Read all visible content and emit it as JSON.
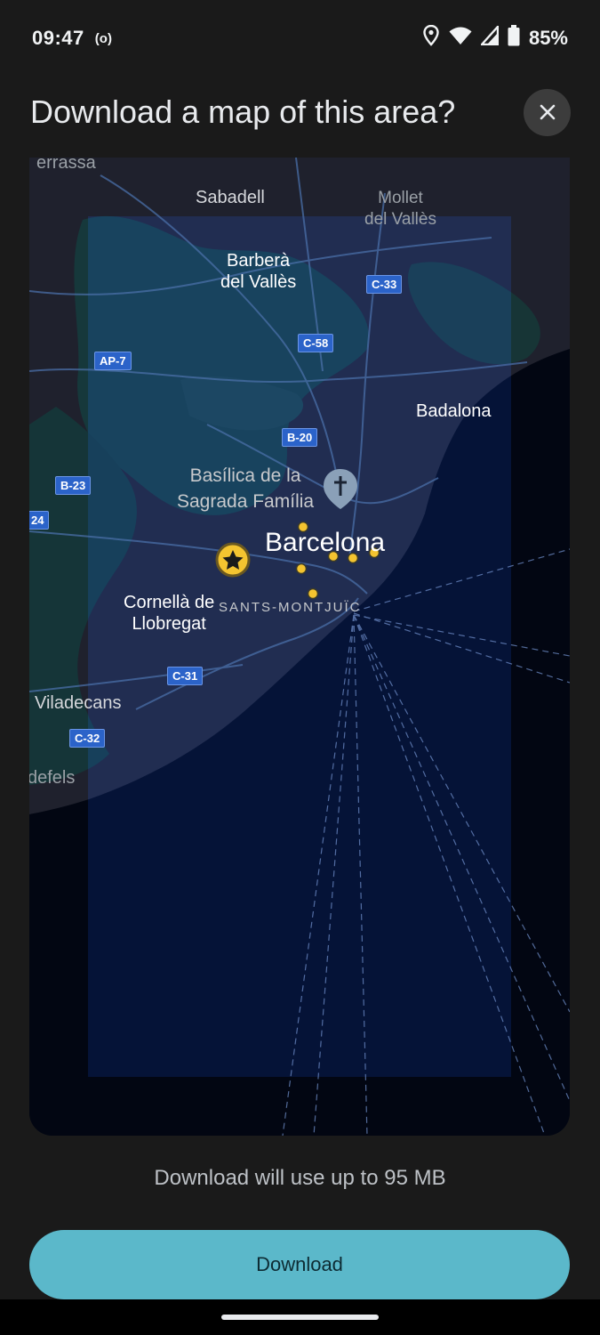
{
  "status_bar": {
    "time": "09:47",
    "radio_indicator": "(o)",
    "battery_percent": "85%",
    "icons": [
      "location-icon",
      "wifi-icon",
      "signal-icon",
      "battery-icon"
    ]
  },
  "dialog": {
    "title": "Download a map of this area?",
    "close_icon": "close-icon"
  },
  "map": {
    "places": {
      "terrassa": "errassa",
      "sabadell": "Sabadell",
      "mollet": "Mollet\ndel Vallès",
      "barbera": "Barberà\ndel Vallès",
      "badalona": "Badalona",
      "basilica": "Basílica de la\nSagrada Família",
      "barcelona": "Barcelona",
      "cornella": "Cornellà de\nLlobregat",
      "sants": "SANTS-MONTJUÏC",
      "viladecans": "Viladecans",
      "castelldefels": "defels"
    },
    "roads": {
      "c33": "C-33",
      "c58": "C-58",
      "ap7": "AP-7",
      "b20": "B-20",
      "b23": "B-23",
      "b24": "24",
      "c31": "C-31",
      "c32": "C-32"
    },
    "colors": {
      "land": "#2b2e3f",
      "green": "#1f4e52",
      "sea": "#03091a",
      "selection": "#071a45",
      "road": "#2b63c9",
      "marker": "#f4c430"
    }
  },
  "size_info": "Download will use up to 95 MB",
  "download_button": "Download"
}
